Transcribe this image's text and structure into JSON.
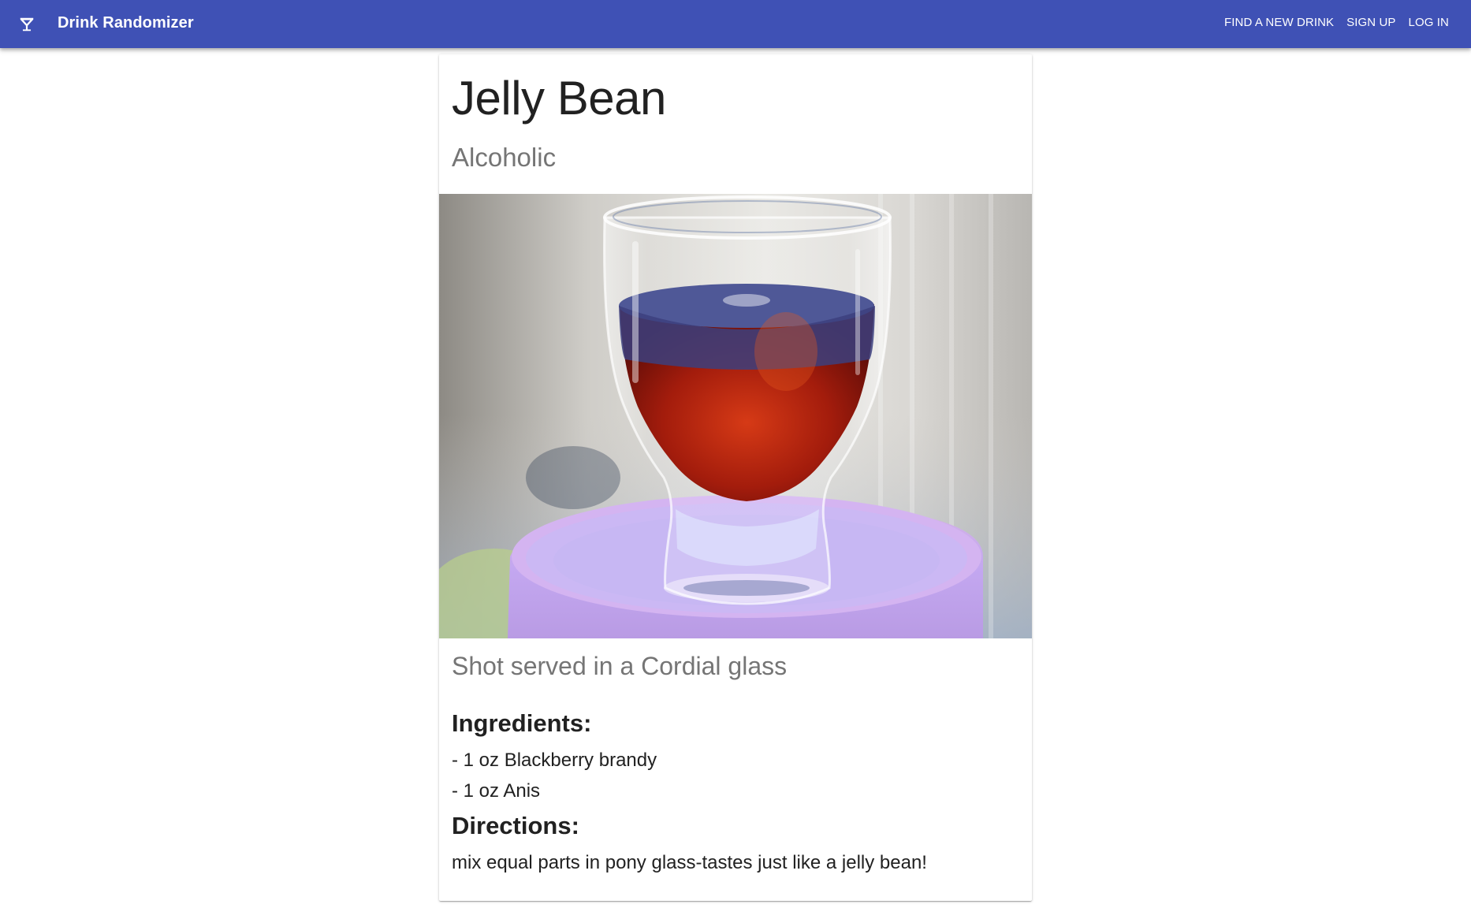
{
  "app": {
    "title": "Drink Randomizer",
    "menu_icon": "cocktail-icon"
  },
  "nav": {
    "find_drink": "FIND A NEW DRINK",
    "sign_up": "SIGN UP",
    "log_in": "LOG IN"
  },
  "drink": {
    "name": "Jelly Bean",
    "category": "Alcoholic",
    "glass_info": "Shot served in a Cordial glass",
    "ingredients_heading": "Ingredients:",
    "ingredients": [
      "- 1 oz Blackberry brandy",
      "- 1 oz Anis"
    ],
    "directions_heading": "Directions:",
    "directions": "mix equal parts in pony glass-tastes just like a jelly bean!"
  },
  "colors": {
    "appbar": "#3f51b5",
    "text_primary": "#212121",
    "text_secondary": "#757575"
  }
}
